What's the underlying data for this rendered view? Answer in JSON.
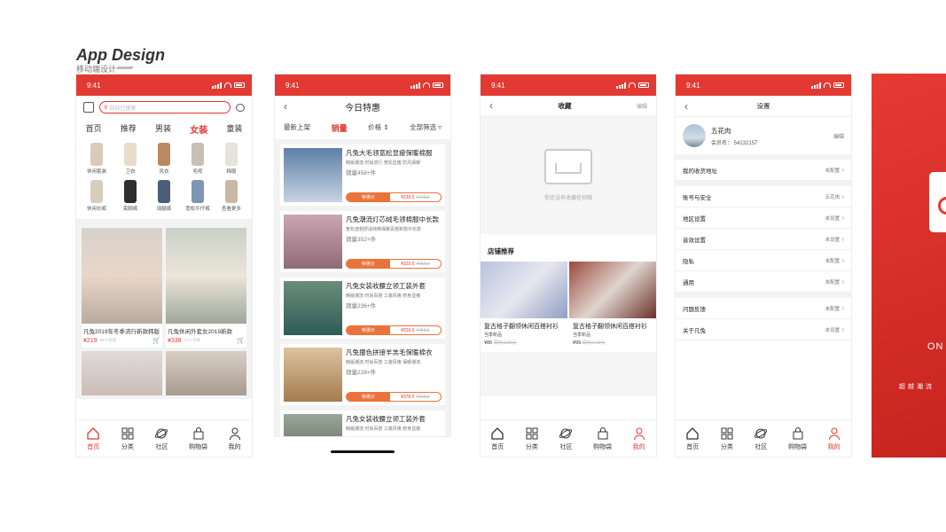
{
  "header": {
    "title": "App Design",
    "subtitle": "移动端设计"
  },
  "status_time": "9:41",
  "tabbar": [
    "首页",
    "分类",
    "社区",
    "购物袋",
    "我的"
  ],
  "phone1": {
    "search_placeholder": "目前已搜索",
    "cat_tabs": [
      "首页",
      "推荐",
      "男装",
      "女装",
      "童装"
    ],
    "categories": [
      "休闲套装",
      "卫衣",
      "风衣",
      "毛呢",
      "棉服",
      "休闲长裤",
      "束脚裤",
      "阔腿裤",
      "宽松牛仔裤",
      "查看更多"
    ],
    "products": [
      {
        "name": "凡兔2019年冬季流行新款韩版",
        "price": "¥219",
        "sold": "68人付款"
      },
      {
        "name": "凡兔休闲外套女2019新款",
        "price": "¥338",
        "sold": "12人付款"
      }
    ]
  },
  "phone2": {
    "title": "今日特惠",
    "filters": [
      "最新上架",
      "销量",
      "价格",
      "全部筛选"
    ],
    "items": [
      {
        "name": "凡兔大毛领宽松显瘦保暖棉服",
        "tags": "韩版潮流  时尚流行  宽松显瘦  防风保暖",
        "sales": "销量458+件",
        "price": "¥239.0",
        "old": "¥479.0"
      },
      {
        "name": "凡兔潮流灯芯绒毛领棉服中长款",
        "tags": "宽松连帽舒适纯棉保暖百搭新款中长款",
        "sales": "销量352+件",
        "price": "¥329.0",
        "old": "¥659.0"
      },
      {
        "name": "凡兔女装收腰立领工装外套",
        "tags": "韩版潮流  时尚百搭  工装风格  修身显瘦",
        "sales": "销量236+件",
        "price": "¥229.0",
        "old": "¥459.0"
      },
      {
        "name": "凡兔撞色拼接羊羔毛保暖棉衣",
        "tags": "韩版潮流  时尚百搭  工装风格  保暖潮流",
        "sales": "销量228+件",
        "price": "¥378.0",
        "old": "¥699.0"
      },
      {
        "name": "凡兔女装收腰立领工装外套",
        "tags": "韩版潮流  时尚百搭  工装风格  修身显瘦",
        "sales": "",
        "price": "",
        "old": ""
      }
    ],
    "pill_label": "特惠价"
  },
  "phone3": {
    "title": "收藏",
    "edit": "编辑",
    "empty_msg": "你还没有收藏任何哦",
    "rec_title": "店铺推荐",
    "recs": [
      {
        "name": "复古格子翻领休闲百搭衬衫",
        "sub": "当季新品",
        "price": "¥86",
        "old": "原价128元"
      },
      {
        "name": "复古格子翻领休闲百搭衬衫",
        "sub": "当季新品",
        "price": "¥99",
        "old": "原价148元"
      }
    ]
  },
  "phone4": {
    "title": "设置",
    "user_name": "五花肉",
    "member_id": "会员名： 54132157",
    "edit": "编辑",
    "rows": [
      {
        "label": "我的收货地址",
        "value": "未配置"
      },
      {
        "label": "账号与安全",
        "value": "五花肉"
      },
      {
        "label": "地区设置",
        "value": "未设置"
      },
      {
        "label": "音效设置",
        "value": "未设置"
      },
      {
        "label": "隐私",
        "value": "未配置"
      },
      {
        "label": "通用",
        "value": "未配置"
      },
      {
        "label": "问题反馈",
        "value": "未配置"
      },
      {
        "label": "关于凡兔",
        "value": "未设置"
      }
    ]
  },
  "phone5": {
    "text": "ON",
    "slogan": "超越潮流"
  },
  "colors": {
    "brand": "#e23a32",
    "accent": "#e8743b"
  }
}
